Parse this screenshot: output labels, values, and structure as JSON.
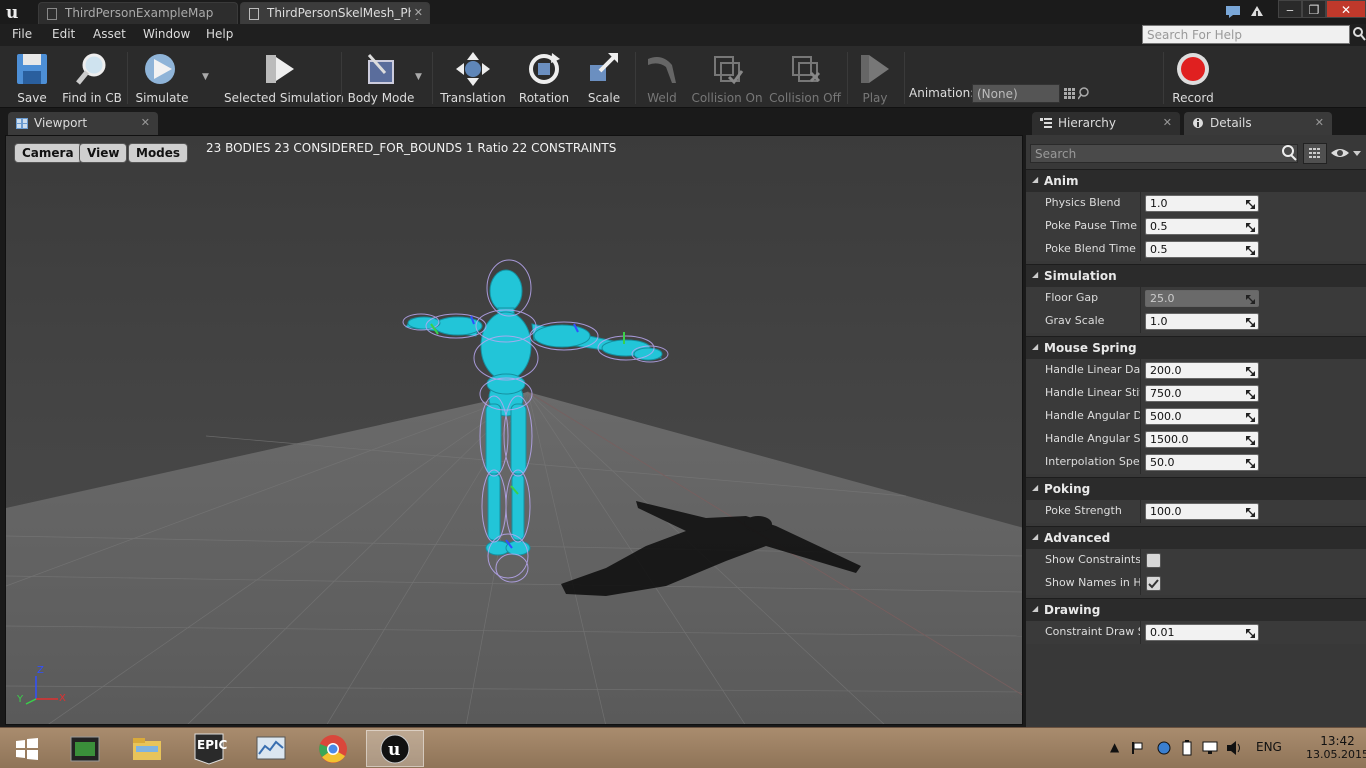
{
  "titlebar": {
    "tabs": [
      {
        "label": "ThirdPersonExampleMap"
      },
      {
        "label": "ThirdPersonSkelMesh_Phy"
      }
    ]
  },
  "menu": {
    "items": [
      "File",
      "Edit",
      "Asset",
      "Window",
      "Help"
    ],
    "help_search_placeholder": "Search For Help"
  },
  "toolbar": {
    "save": "Save",
    "find_in_cb": "Find in CB",
    "simulate": "Simulate",
    "selected_simulation": "Selected Simulation",
    "body_mode": "Body Mode",
    "translation": "Translation",
    "rotation": "Rotation",
    "scale": "Scale",
    "weld": "Weld",
    "collision_on": "Collision On",
    "collision_off": "Collision Off",
    "play": "Play",
    "animation_label": "Animation:",
    "animation_value": "(None)",
    "record": "Record"
  },
  "viewport": {
    "tab_label": "Viewport",
    "buttons": {
      "camera": "Camera",
      "view": "View",
      "modes": "Modes"
    },
    "stats": "23 BODIES  23 CONSIDERED_FOR_BOUNDS  1 Ratio  22 CONSTRAINTS",
    "axis": {
      "x": "X",
      "y": "Y",
      "z": "Z"
    }
  },
  "right_panel": {
    "tabs": {
      "hierarchy": "Hierarchy",
      "details": "Details"
    },
    "search_placeholder": "Search"
  },
  "details": {
    "sections": [
      {
        "title": "Anim",
        "props": [
          {
            "name": "Physics Blend",
            "value": "1.0"
          },
          {
            "name": "Poke Pause Time",
            "value": "0.5"
          },
          {
            "name": "Poke Blend Time",
            "value": "0.5"
          }
        ]
      },
      {
        "title": "Simulation",
        "props": [
          {
            "name": "Floor Gap",
            "value": "25.0"
          },
          {
            "name": "Grav Scale",
            "value": "1.0"
          }
        ]
      },
      {
        "title": "Mouse Spring",
        "props": [
          {
            "name": "Handle Linear Dam",
            "value": "200.0"
          },
          {
            "name": "Handle Linear Stiff",
            "value": "750.0"
          },
          {
            "name": "Handle Angular Dar",
            "value": "500.0"
          },
          {
            "name": "Handle Angular Sti",
            "value": "1500.0"
          },
          {
            "name": "Interpolation Speec",
            "value": "50.0"
          }
        ]
      },
      {
        "title": "Poking",
        "props": [
          {
            "name": "Poke Strength",
            "value": "100.0"
          }
        ]
      },
      {
        "title": "Advanced",
        "props": [
          {
            "name": "Show Constraints a",
            "checked": false
          },
          {
            "name": "Show Names in Hie",
            "checked": true
          }
        ]
      },
      {
        "title": "Drawing",
        "props": [
          {
            "name": "Constraint Draw Si",
            "value": "0.01"
          }
        ]
      }
    ]
  },
  "taskbar": {
    "epic_label": "EPIC",
    "language": "ENG",
    "time": "13:42",
    "date": "13.05.2015"
  },
  "colors": {
    "accent_cyan": "#22c5d8",
    "record_red": "#e02020",
    "panel_bg": "#383838"
  }
}
